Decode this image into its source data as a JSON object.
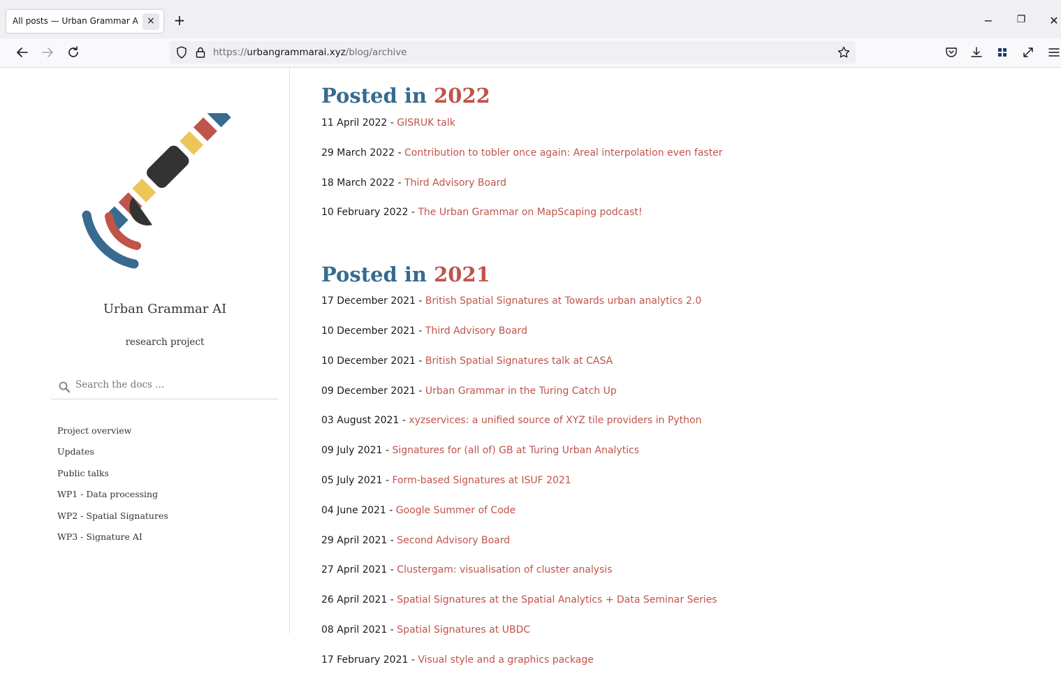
{
  "browser": {
    "tab_title": "All posts — Urban Grammar AI documentation",
    "tab_close": "×",
    "new_tab": "+",
    "url_scheme": "https://",
    "url_host": "urbangrammarai.xyz",
    "url_path": "/blog/archive",
    "window_minimize": "−",
    "window_restore": "❐",
    "window_close": "✕"
  },
  "sidebar": {
    "title": "Urban Grammar AI",
    "subtitle": "research project",
    "search_placeholder": "Search the docs ...",
    "nav": [
      {
        "label": "Project overview"
      },
      {
        "label": "Updates"
      },
      {
        "label": "Public talks"
      },
      {
        "label": "WP1 - Data processing"
      },
      {
        "label": "WP2 - Spatial Signatures"
      },
      {
        "label": "WP3 - Signature AI"
      }
    ]
  },
  "main": {
    "sections": [
      {
        "prefix": "Posted in ",
        "year": "2022",
        "posts": [
          {
            "date": "11 April 2022",
            "title": "GISRUK talk"
          },
          {
            "date": "29 March 2022",
            "title": "Contribution to tobler once again: Areal interpolation even faster"
          },
          {
            "date": "18 March 2022",
            "title": "Third Advisory Board"
          },
          {
            "date": "10 February 2022",
            "title": "The Urban Grammar on MapScaping podcast!"
          }
        ]
      },
      {
        "prefix": "Posted in ",
        "year": "2021",
        "posts": [
          {
            "date": "17 December 2021",
            "title": "British Spatial Signatures at Towards urban analytics 2.0"
          },
          {
            "date": "10 December 2021",
            "title": "Third Advisory Board"
          },
          {
            "date": "10 December 2021",
            "title": "British Spatial Signatures talk at CASA"
          },
          {
            "date": "09 December 2021",
            "title": "Urban Grammar in the Turing Catch Up"
          },
          {
            "date": "03 August 2021",
            "title": "xyzservices: a unified source of XYZ tile providers in Python"
          },
          {
            "date": "09 July 2021",
            "title": "Signatures for (all of) GB at Turing Urban Analytics"
          },
          {
            "date": "05 July 2021",
            "title": "Form-based Signatures at ISUF 2021"
          },
          {
            "date": "04 June 2021",
            "title": "Google Summer of Code"
          },
          {
            "date": "29 April 2021",
            "title": "Second Advisory Board"
          },
          {
            "date": "27 April 2021",
            "title": "Clustergam: visualisation of cluster analysis"
          },
          {
            "date": "26 April 2021",
            "title": "Spatial Signatures at the Spatial Analytics + Data Seminar Series"
          },
          {
            "date": "08 April 2021",
            "title": "Spatial Signatures at UBDC"
          },
          {
            "date": "17 February 2021",
            "title": "Visual style and a graphics package"
          }
        ]
      }
    ],
    "separator": " - "
  },
  "colors": {
    "heading_blue": "#376b8f",
    "link_red": "#c0544a",
    "logo_yellow": "#edc65a",
    "logo_dark": "#333333"
  }
}
